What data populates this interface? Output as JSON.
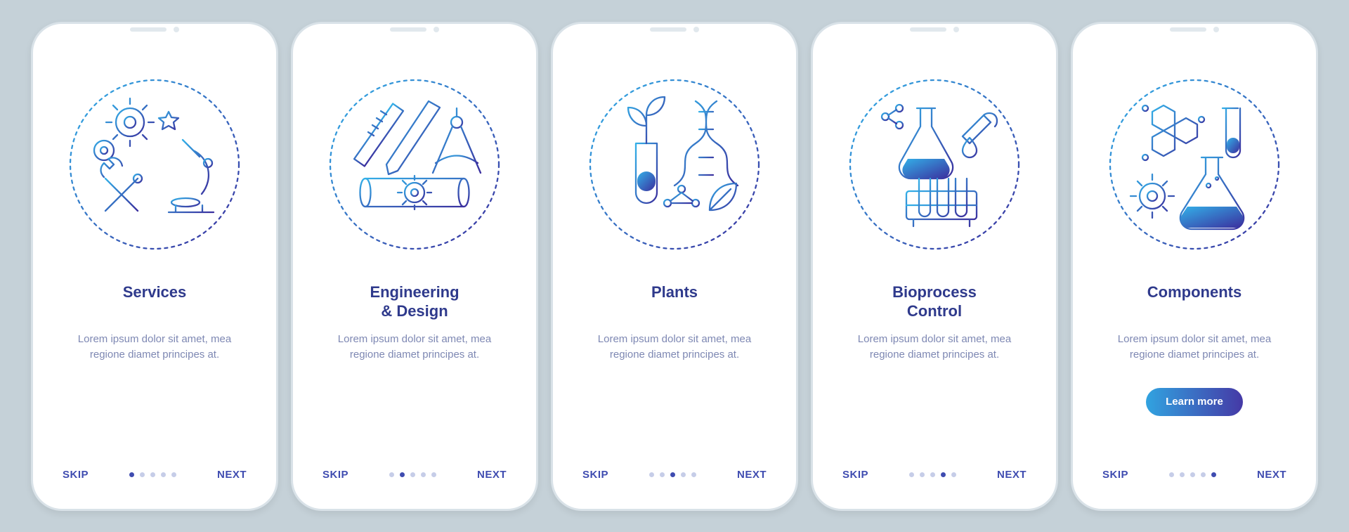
{
  "common": {
    "skip_label": "SKIP",
    "next_label": "NEXT",
    "desc": "Lorem ipsum dolor sit amet, mea regione diamet principes at.",
    "cta_label": "Learn more",
    "total_dots": 5
  },
  "screens": [
    {
      "title": "Services",
      "active_dot": 0,
      "has_cta": false,
      "icon": "services-icon"
    },
    {
      "title": "Engineering\n& Design",
      "active_dot": 1,
      "has_cta": false,
      "icon": "engineering-icon"
    },
    {
      "title": "Plants",
      "active_dot": 2,
      "has_cta": false,
      "icon": "plants-icon"
    },
    {
      "title": "Bioprocess\nControl",
      "active_dot": 3,
      "has_cta": false,
      "icon": "bioprocess-icon"
    },
    {
      "title": "Components",
      "active_dot": 4,
      "has_cta": true,
      "icon": "components-icon"
    }
  ],
  "colors": {
    "gradient_from": "#33b0e8",
    "gradient_to": "#3b2f9e",
    "heading": "#2f3a8c",
    "body": "#7e88b3",
    "bg": "#c5d1d8"
  }
}
